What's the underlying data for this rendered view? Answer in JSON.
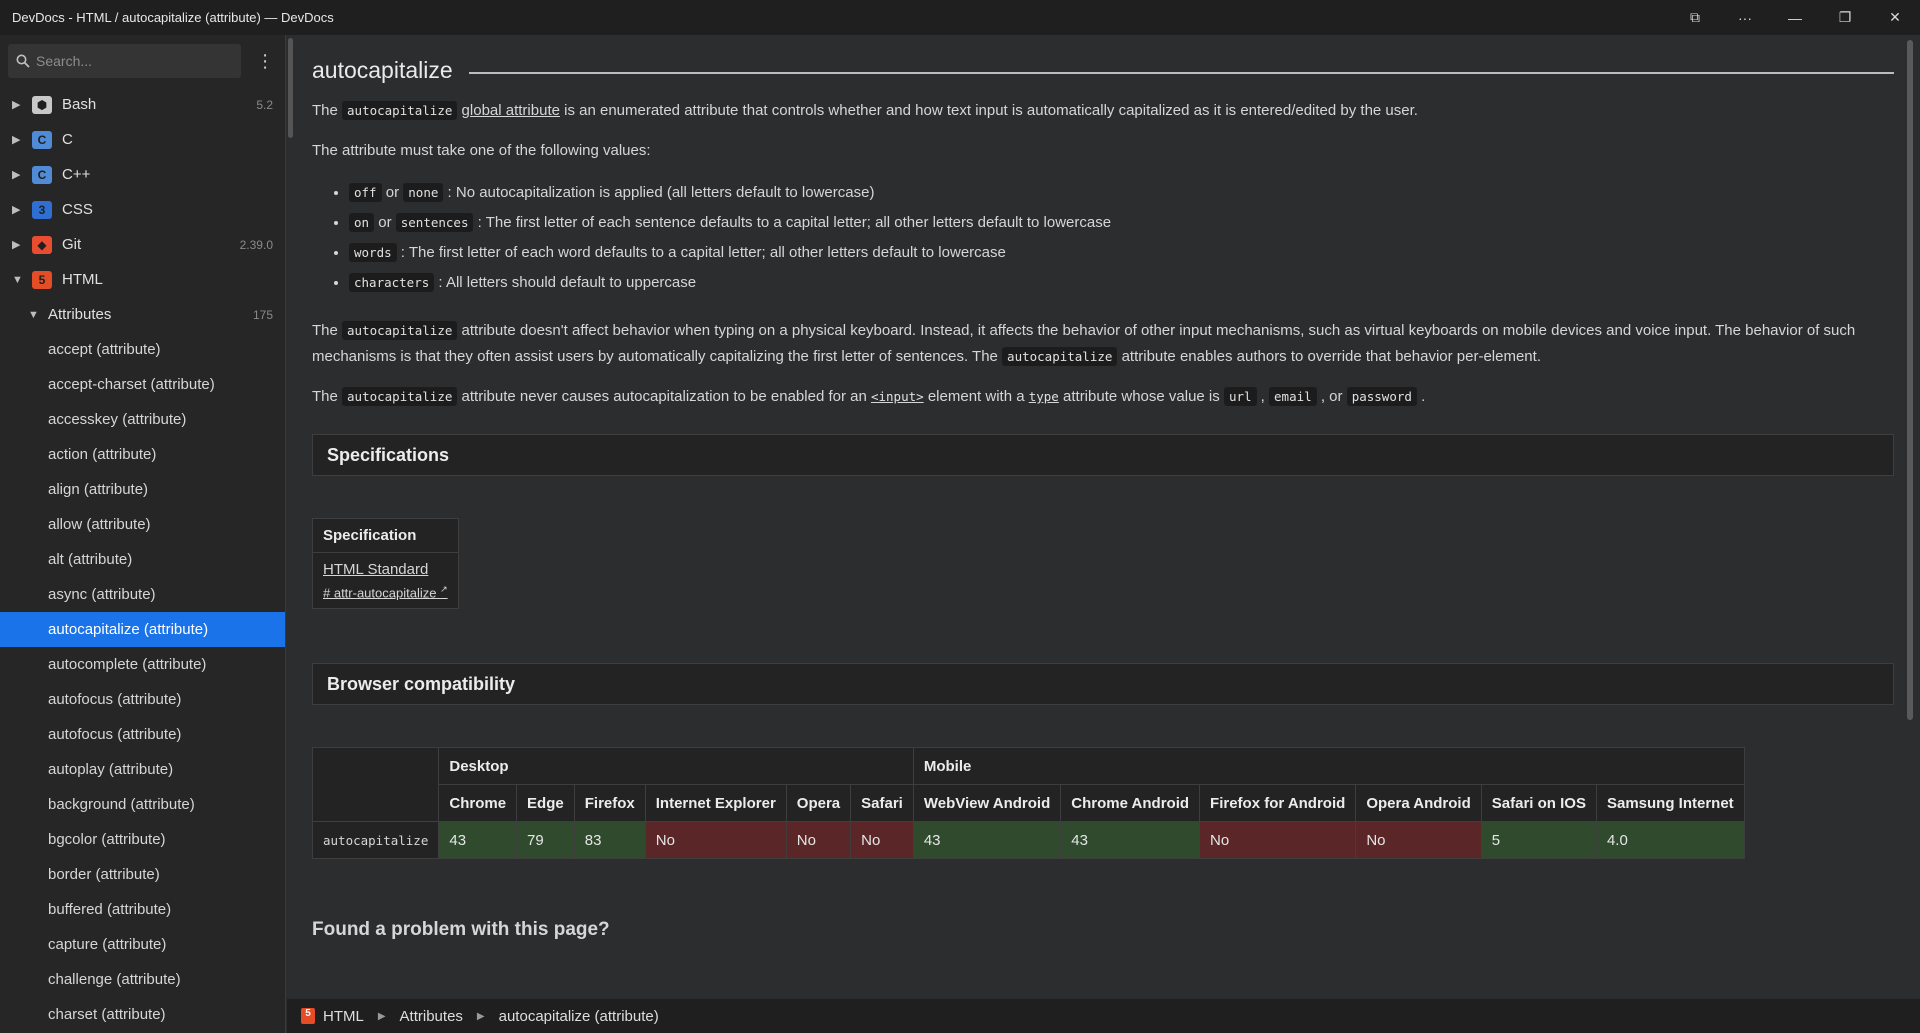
{
  "window": {
    "title": "DevDocs - HTML / autocapitalize (attribute) — DevDocs",
    "controls": [
      "⧉",
      "···",
      "—",
      "❐",
      "✕"
    ]
  },
  "sidebar": {
    "search_placeholder": "Search...",
    "docs": [
      {
        "name": "Bash",
        "version": "5.2",
        "logo_color": "#c8c8c8"
      },
      {
        "name": "C",
        "version": "",
        "logo_color": "#4f8bd6"
      },
      {
        "name": "C++",
        "version": "",
        "logo_color": "#4f8bd6"
      },
      {
        "name": "CSS",
        "version": "",
        "logo_color": "#2f6fd1"
      },
      {
        "name": "Git",
        "version": "2.39.0",
        "logo_color": "#e84d31"
      },
      {
        "name": "HTML",
        "version": "",
        "logo_color": "#e44d26"
      }
    ],
    "attributes_group": {
      "label": "Attributes",
      "count": "175"
    },
    "attributes": [
      "accept (attribute)",
      "accept-charset (attribute)",
      "accesskey (attribute)",
      "action (attribute)",
      "align (attribute)",
      "allow (attribute)",
      "alt (attribute)",
      "async (attribute)",
      "autocapitalize (attribute)",
      "autocomplete (attribute)",
      "autofocus (attribute)",
      "autofocus (attribute)",
      "autoplay (attribute)",
      "background (attribute)",
      "bgcolor (attribute)",
      "border (attribute)",
      "buffered (attribute)",
      "capture (attribute)",
      "challenge (attribute)",
      "charset (attribute)"
    ],
    "active_index": 8
  },
  "content": {
    "title": "autocapitalize",
    "p1": {
      "pre": "The ",
      "code": "autocapitalize",
      "link": "global attribute",
      "post": " is an enumerated attribute that controls whether and how text input is automatically capitalized as it is entered/edited by the user."
    },
    "p2": "The attribute must take one of the following values:",
    "values": [
      {
        "c1": "off",
        "mid": " or ",
        "c2": "none",
        "text": " : No autocapitalization is applied (all letters default to lowercase)"
      },
      {
        "c1": "on",
        "mid": " or ",
        "c2": "sentences",
        "text": " : The first letter of each sentence defaults to a capital letter; all other letters default to lowercase"
      },
      {
        "c1": "words",
        "mid": "",
        "c2": "",
        "text": " : The first letter of each word defaults to a capital letter; all other letters default to lowercase"
      },
      {
        "c1": "characters",
        "mid": "",
        "c2": "",
        "text": " : All letters should default to uppercase"
      }
    ],
    "p3": {
      "pre": "The ",
      "code1": "autocapitalize",
      "mid": " attribute doesn't affect behavior when typing on a physical keyboard. Instead, it affects the behavior of other input mechanisms, such as virtual keyboards on mobile devices and voice input. The behavior of such mechanisms is that they often assist users by automatically capitalizing the first letter of sentences. The ",
      "code2": "autocapitalize",
      "post": " attribute enables authors to override that behavior per-element."
    },
    "p4": {
      "pre": "The ",
      "code": "autocapitalize",
      "a": " attribute never causes autocapitalization to be enabled for an ",
      "link1": "<input>",
      "b": " element with a ",
      "link2": "type",
      "c": " attribute whose value is ",
      "v1": "url",
      "sep1": " , ",
      "v2": "email",
      "sep2": " , or ",
      "v3": "password",
      "end": " ."
    },
    "spec_heading": "Specifications",
    "spec_table": {
      "header": "Specification",
      "link": "HTML Standard",
      "anchor": "# attr-autocapitalize"
    },
    "compat_heading": "Browser compatibility",
    "compat": {
      "groups": [
        "Desktop",
        "Mobile"
      ],
      "browsers": [
        "Chrome",
        "Edge",
        "Firefox",
        "Internet Explorer",
        "Opera",
        "Safari",
        "WebView Android",
        "Chrome Android",
        "Firefox for Android",
        "Opera Android",
        "Safari on IOS",
        "Samsung Internet"
      ],
      "row_name": "autocapitalize",
      "values": [
        "43",
        "79",
        "83",
        "No",
        "No",
        "No",
        "43",
        "43",
        "No",
        "No",
        "5",
        "4.0"
      ]
    },
    "found_problem": "Found a problem with this page?"
  },
  "breadcrumb": [
    "HTML",
    "Attributes",
    "autocapitalize (attribute)"
  ]
}
